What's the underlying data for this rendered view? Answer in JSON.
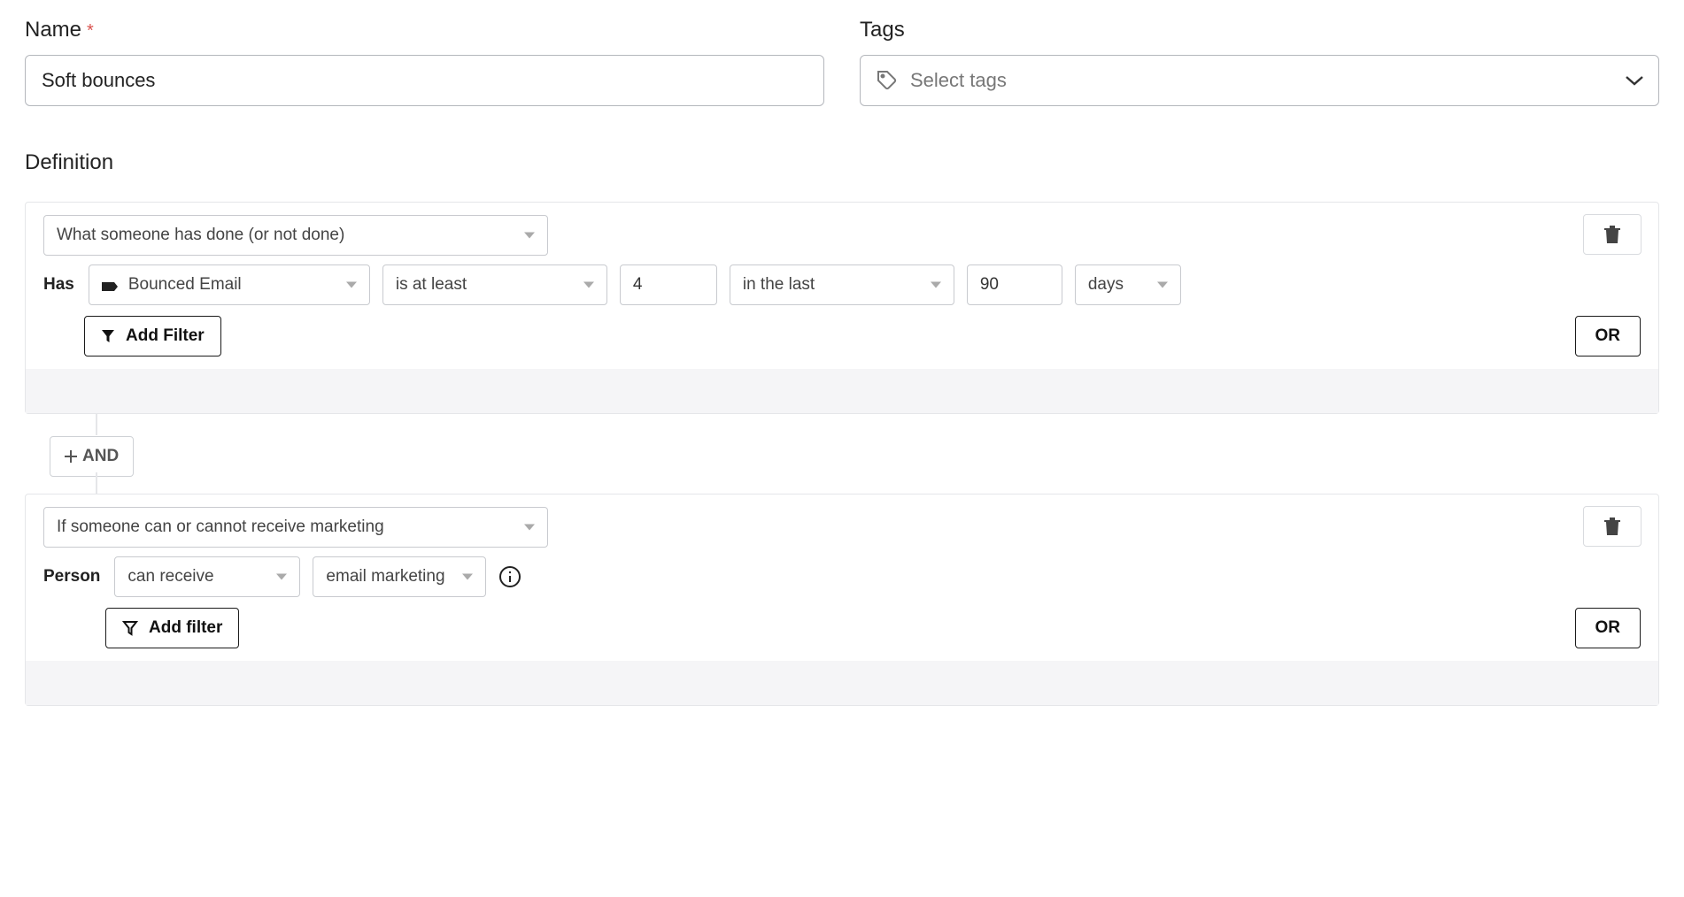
{
  "fields": {
    "name": {
      "label": "Name",
      "value": "Soft bounces"
    },
    "tags": {
      "label": "Tags",
      "placeholder": "Select tags"
    }
  },
  "section": {
    "definition_heading": "Definition"
  },
  "group1": {
    "type_label": "What someone has done (or not done)",
    "prefix": "Has",
    "metric": "Bounced Email",
    "operator": "is at least",
    "count": "4",
    "timeframe": "in the last",
    "duration": "90",
    "unit": "days",
    "add_filter": "Add Filter",
    "or_label": "OR"
  },
  "connector": {
    "and_label": "AND"
  },
  "group2": {
    "type_label": "If someone can or cannot receive marketing",
    "prefix": "Person",
    "can": "can receive",
    "channel": "email marketing",
    "add_filter": "Add filter",
    "or_label": "OR"
  }
}
